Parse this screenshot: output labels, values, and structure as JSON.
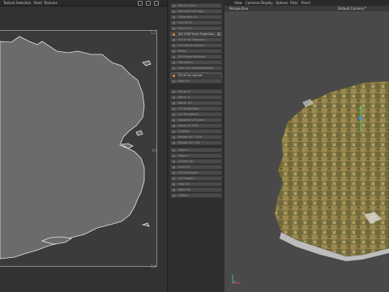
{
  "uv_editor": {
    "menu": [
      "Texture Selection",
      "Paint",
      "Textures"
    ],
    "ticks": {
      "top_right": "1,1",
      "mid_right": "0,5",
      "bottom_right": "1,0"
    }
  },
  "command_list": {
    "group1": [
      "Set UV Grid",
      "Recreate UV Map",
      "Generate UV",
      "Flip UV H",
      "Flip UV V",
      "Set UVW from Projection...",
      "Fit UV to Selection",
      "UV Island Outline",
      "Relax",
      "UV Relax/Optimize",
      "Transform",
      "Pack UV Islands/Packing",
      "Best Projection Fit UV"
    ],
    "group2": [
      "Fit UV to Canvas",
      "Sort UV"
    ],
    "group3": [
      "Mirror U",
      "Mirror V",
      "Mirror UV",
      "UV Snap/Align",
      "UV Straighten",
      "Equalize UV Scale",
      "Snap UV Grid",
      "Cut/Join",
      "Rotate 90° CCW",
      "Rotate 90° CW"
    ],
    "group4": [
      "Align U",
      "Align V",
      "Center UV",
      "Split UV",
      "UV Distribute",
      "UV Flatten",
      "Sew UV",
      "Weld UV",
      "Unfold"
    ],
    "highlight_label": "Set UVW from Projection...",
    "canvas_label": "Fit UV to Canvas"
  },
  "viewport": {
    "menu": [
      "View",
      "Cameras",
      "Display",
      "Options",
      "Filter",
      "Panel"
    ],
    "projection_label": "Perspective",
    "camera_label": "Default Camera:*"
  },
  "colors": {
    "accent_orange": "#d98a2b",
    "axis_x": "#e04848",
    "axis_y": "#4cc45a",
    "axis_z": "#4a8fe0"
  }
}
